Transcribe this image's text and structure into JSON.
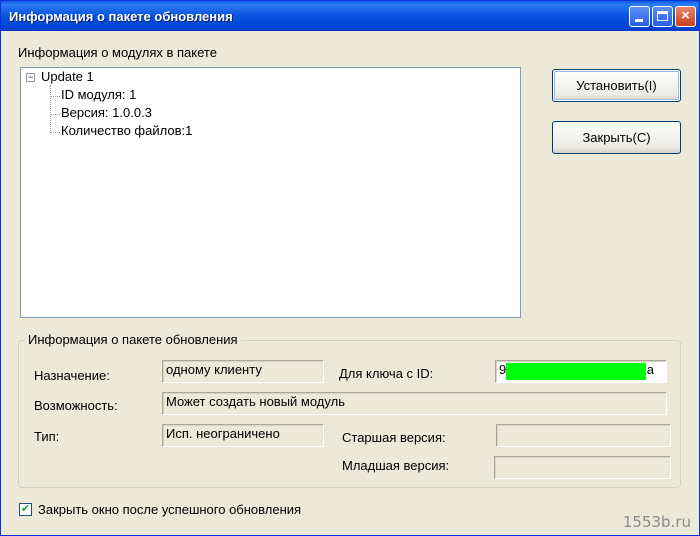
{
  "window": {
    "title": "Информация о пакете обновления",
    "controls": {
      "minimize": "minimize",
      "maximize": "maximize",
      "close": "×"
    }
  },
  "modules": {
    "heading": "Информация о модулях в пакете",
    "tree": {
      "root_label": "Update 1",
      "expander": "−",
      "children": [
        "ID модуля: 1",
        "Версия: 1.0.0.3",
        "Количество файлов:1"
      ]
    }
  },
  "buttons": {
    "install": "Установить(I)",
    "close": "Закрыть(C)"
  },
  "package": {
    "group_title": "Информация о пакете обновления",
    "purpose_label": "Назначение:",
    "purpose_value": "одному клиенту",
    "key_label": "Для ключа с ID:",
    "key_value_prefix": "9",
    "key_value_suffix": "a",
    "capability_label": "Возможность:",
    "capability_value": "Может создать новый модуль",
    "type_label": "Тип:",
    "type_value": "Исп. неограничено",
    "max_version_label": "Старшая версия:",
    "max_version_value": "",
    "min_version_label": "Младшая версия:",
    "min_version_value": ""
  },
  "options": {
    "close_after_update_label": "Закрыть окно после успешного обновления",
    "close_after_update_checked": true,
    "check_mark": "✔"
  },
  "watermark": "1553b.ru",
  "colors": {
    "titlebar": "#0a56e0",
    "window_bg": "#ece9d8",
    "redaction": "#00ff0e"
  }
}
